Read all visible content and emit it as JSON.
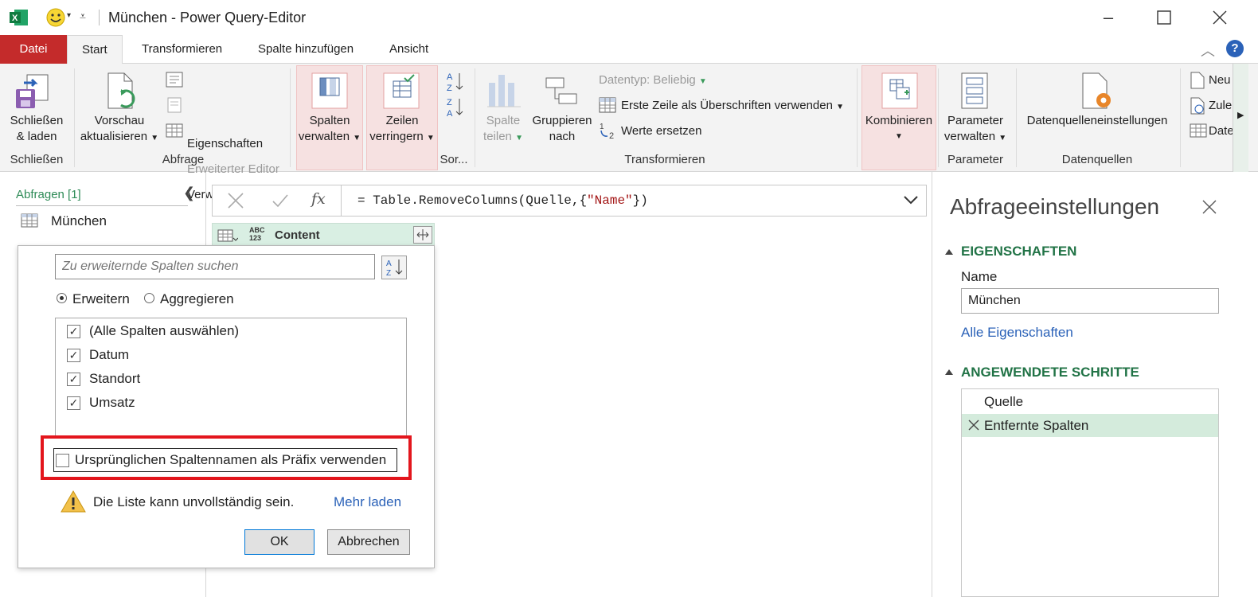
{
  "window": {
    "title": "München - Power Query-Editor"
  },
  "tabs": [
    {
      "label": "Datei"
    },
    {
      "label": "Start"
    },
    {
      "label": "Transformieren"
    },
    {
      "label": "Spalte hinzufügen"
    },
    {
      "label": "Ansicht"
    }
  ],
  "ribbon": {
    "close_load": {
      "line1": "Schließen",
      "line2": "& laden",
      "group": "Schließen"
    },
    "refresh": {
      "line1": "Vorschau",
      "line2": "aktualisieren"
    },
    "properties": "Eigenschaften",
    "advanced_editor": "Erweiterter Editor",
    "manage": "Verwalten",
    "query_group": "Abfrage",
    "manage_cols": {
      "line1": "Spalten",
      "line2": "verwalten"
    },
    "reduce_rows": {
      "line1": "Zeilen",
      "line2": "verringern"
    },
    "sort_group": "Sor...",
    "split_col": {
      "line1": "Spalte",
      "line2": "teilen"
    },
    "group_by": {
      "line1": "Gruppieren",
      "line2": "nach"
    },
    "datatype": "Datentyp: Beliebig",
    "first_row_headers": "Erste Zeile als Überschriften verwenden",
    "replace_values": "Werte ersetzen",
    "transform_group": "Transformieren",
    "combine": "Kombinieren",
    "params": {
      "line1": "Parameter",
      "line2": "verwalten",
      "group": "Parameter"
    },
    "datasource_settings": "Datenquelleneinstellungen",
    "datasources_group": "Datenquellen",
    "new_source": "Neu",
    "recent": "Zule",
    "enter_data": "Date"
  },
  "queries": {
    "header": "Abfragen [1]",
    "items": [
      {
        "label": "München"
      }
    ]
  },
  "formula_bar": {
    "fx": "fx",
    "prefix": "= Table.RemoveColumns(Quelle,{",
    "string": "\"Name\"",
    "suffix": "})"
  },
  "column": {
    "type_label": "ABC\n123",
    "name": "Content"
  },
  "expand_dialog": {
    "search_placeholder": "Zu erweiternde Spalten suchen",
    "mode_expand": "Erweitern",
    "mode_aggregate": "Aggregieren",
    "columns": [
      {
        "label": "(Alle Spalten auswählen)",
        "checked": true
      },
      {
        "label": "Datum",
        "checked": true
      },
      {
        "label": "Standort",
        "checked": true
      },
      {
        "label": "Umsatz",
        "checked": true
      }
    ],
    "prefix_option": {
      "label": "Ursprünglichen Spaltennamen als Präfix verwenden",
      "checked": false
    },
    "warning": "Die Liste kann unvollständig sein.",
    "load_more": "Mehr laden",
    "ok": "OK",
    "cancel": "Abbrechen"
  },
  "settings": {
    "title": "Abfrageeinstellungen",
    "properties_section": "EIGENSCHAFTEN",
    "name_label": "Name",
    "name_value": "München",
    "all_properties": "Alle Eigenschaften",
    "steps_section": "ANGEWENDETE SCHRITTE",
    "steps": [
      {
        "label": "Quelle"
      },
      {
        "label": "Entfernte Spalten"
      }
    ]
  },
  "colors": {
    "file_tab": "#c42b2b",
    "accent_green": "#217346",
    "highlight_red": "#e3161d",
    "link_blue": "#2b62b8"
  }
}
